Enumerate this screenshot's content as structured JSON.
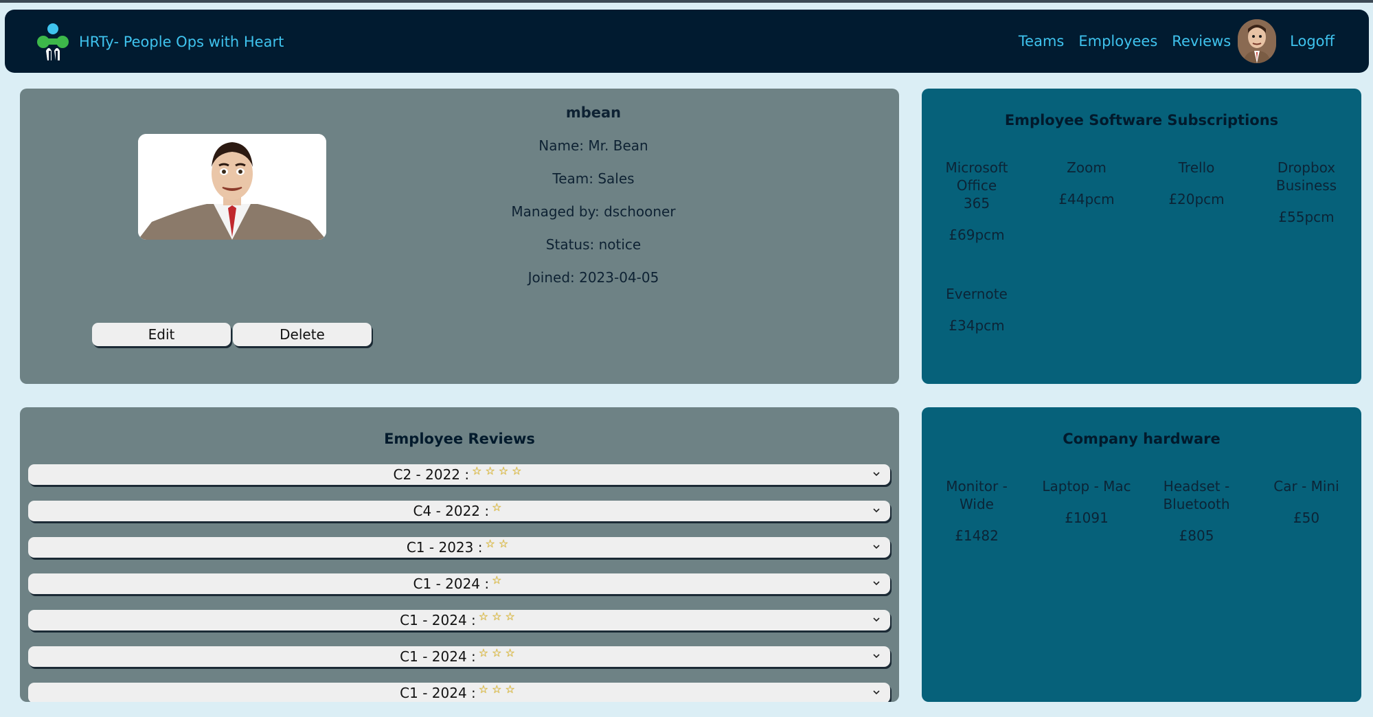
{
  "navbar": {
    "brand": "HRTy- People Ops with Heart",
    "links": [
      "Teams",
      "Employees",
      "Reviews"
    ],
    "logoff": "Logoff"
  },
  "profile": {
    "username": "mbean",
    "name": "Name: Mr. Bean",
    "team": "Team: Sales",
    "managed_by": "Managed by: dschooner",
    "status": "Status: notice",
    "joined": "Joined: 2023-04-05",
    "edit_label": "Edit",
    "delete_label": "Delete"
  },
  "software": {
    "title": "Employee Software Subscriptions",
    "items": [
      {
        "name": "Microsoft Office 365",
        "price": "£69pcm"
      },
      {
        "name": "Zoom",
        "price": "£44pcm"
      },
      {
        "name": "Trello",
        "price": "£20pcm"
      },
      {
        "name": "Dropbox Business",
        "price": "£55pcm"
      },
      {
        "name": "Evernote",
        "price": "£34pcm"
      }
    ]
  },
  "hardware": {
    "title": "Company hardware",
    "items": [
      {
        "name": "Monitor - Wide",
        "price": "£1482"
      },
      {
        "name": "Laptop - Mac",
        "price": "£1091"
      },
      {
        "name": "Headset - Bluetooth",
        "price": "£805"
      },
      {
        "name": "Car - Mini",
        "price": "£50"
      }
    ]
  },
  "reviews": {
    "title": "Employee Reviews",
    "items": [
      {
        "label": "C2 - 2022 :",
        "stars": 4
      },
      {
        "label": "C4 - 2022 :",
        "stars": 1
      },
      {
        "label": "C1 - 2023 :",
        "stars": 2
      },
      {
        "label": "C1 - 2024 :",
        "stars": 1
      },
      {
        "label": "C1 - 2024 :",
        "stars": 3
      },
      {
        "label": "C1 - 2024 :",
        "stars": 3
      },
      {
        "label": "C1 - 2024 :",
        "stars": 3
      }
    ]
  },
  "icons": {
    "logo": "people-logo-icon",
    "chevron": "chevron-down-icon",
    "star": "star-icon"
  },
  "colors": {
    "navbar": "#011b30",
    "link": "#3fc3ee",
    "page_bg": "#dbeef5",
    "panel_grey": "#6e8285",
    "panel_teal": "#06617a",
    "star": "#f5c518"
  }
}
